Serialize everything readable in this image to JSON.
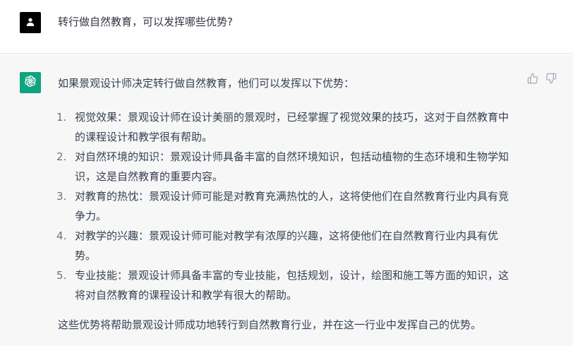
{
  "user_message": {
    "text": "转行做自然教育，可以发挥哪些优势?"
  },
  "assistant_message": {
    "intro": "如果景观设计师决定转行做自然教育，他们可以发挥以下优势：",
    "points": [
      {
        "num": "1.",
        "text": "视觉效果：景观设计师在设计美丽的景观时，已经掌握了视觉效果的技巧，这对于自然教育中的课程设计和教学很有帮助。"
      },
      {
        "num": "2.",
        "text": "对自然环境的知识：景观设计师具备丰富的自然环境知识，包括动植物的生态环境和生物学知识，这是自然教育的重要内容。"
      },
      {
        "num": "3.",
        "text": "对教育的热忱：景观设计师可能是对教育充满热忱的人，这将使他们在自然教育行业内具有竞争力。"
      },
      {
        "num": "4.",
        "text": "对教学的兴趣：景观设计师可能对教学有浓厚的兴趣，这将使他们在自然教育行业内具有优势。"
      },
      {
        "num": "5.",
        "text": "专业技能：景观设计师具备丰富的专业技能，包括规划，设计，绘图和施工等方面的知识，这将对自然教育的课程设计和教学有很大的帮助。"
      }
    ],
    "conclusion": "这些优势将帮助景观设计师成功地转行到自然教育行业，并在这一行业中发挥自己的优势。"
  },
  "icons": {
    "user_avatar": "user-icon",
    "assistant_avatar": "openai-logo-icon",
    "thumbs_up": "thumbs-up-icon",
    "thumbs_down": "thumbs-down-icon"
  },
  "colors": {
    "assistant_avatar_bg": "#10a37f",
    "user_avatar_bg": "#000000",
    "assistant_row_bg": "#f7f7f8"
  }
}
